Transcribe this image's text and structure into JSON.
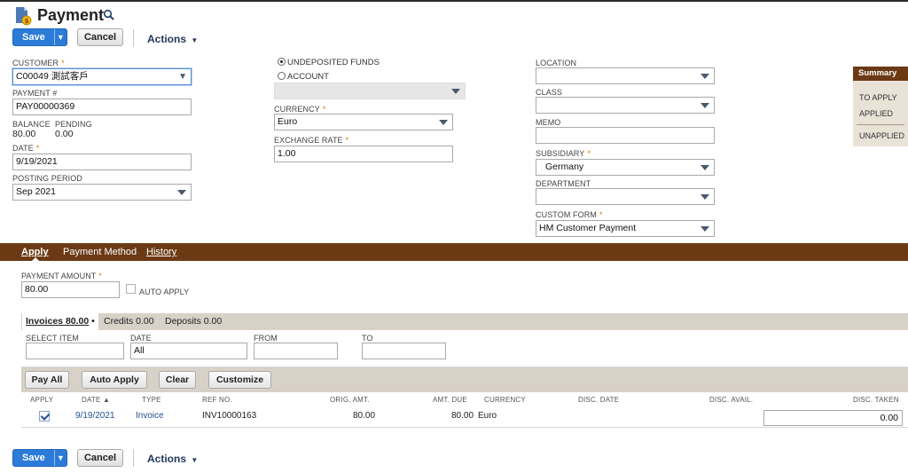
{
  "header": {
    "title": "Payment"
  },
  "toolbar": {
    "save_label": "Save",
    "cancel_label": "Cancel",
    "actions_label": "Actions"
  },
  "fields": {
    "customer": {
      "label": "CUSTOMER",
      "value": "C00049 測試客戶"
    },
    "payment_no": {
      "label": "PAYMENT #",
      "value": "PAY00000369"
    },
    "balance": {
      "label": "BALANCE",
      "value": "80.00"
    },
    "pending": {
      "label": "PENDING",
      "value": "0.00"
    },
    "date": {
      "label": "DATE",
      "value": "9/19/2021"
    },
    "posting_period": {
      "label": "POSTING PERIOD",
      "value": "Sep 2021"
    },
    "undeposited_funds": {
      "label": "UNDEPOSITED FUNDS",
      "checked": true
    },
    "account": {
      "label": "ACCOUNT",
      "value": ""
    },
    "currency": {
      "label": "CURRENCY",
      "value": "Euro"
    },
    "exchange_rate": {
      "label": "EXCHANGE RATE",
      "value": "1.00"
    },
    "location": {
      "label": "LOCATION",
      "value": ""
    },
    "class": {
      "label": "CLASS",
      "value": ""
    },
    "memo": {
      "label": "MEMO",
      "value": ""
    },
    "subsidiary": {
      "label": "SUBSIDIARY",
      "value": "Germany"
    },
    "department": {
      "label": "DEPARTMENT",
      "value": ""
    },
    "custom_form": {
      "label": "CUSTOM FORM",
      "value": "HM Customer Payment"
    }
  },
  "summary": {
    "title": "Summary",
    "to_apply": "TO APPLY",
    "applied": "APPLIED",
    "unapplied": "UNAPPLIED"
  },
  "tabs": [
    {
      "label": "Apply",
      "selected": true
    },
    {
      "label": "Payment Method",
      "selected": false
    },
    {
      "label": "History",
      "selected": false
    }
  ],
  "apply": {
    "payment_amount": {
      "label": "PAYMENT AMOUNT",
      "value": "80.00"
    },
    "auto_apply": {
      "label": "AUTO APPLY",
      "checked": false
    },
    "subtabs": [
      {
        "label": "Invoices 80.00",
        "selected": true
      },
      {
        "label": "Credits 0.00",
        "selected": false
      },
      {
        "label": "Deposits 0.00",
        "selected": false
      }
    ],
    "filters": {
      "select_item": {
        "label": "SELECT ITEM",
        "value": ""
      },
      "date": {
        "label": "DATE",
        "value": "All"
      },
      "from": {
        "label": "FROM",
        "value": ""
      },
      "to": {
        "label": "TO",
        "value": ""
      }
    },
    "buttons": {
      "pay_all": "Pay All",
      "auto_apply": "Auto Apply",
      "clear": "Clear",
      "customize": "Customize"
    },
    "columns": [
      "APPLY",
      "DATE",
      "TYPE",
      "REF NO.",
      "ORIG. AMT.",
      "AMT. DUE",
      "CURRENCY",
      "DISC. DATE",
      "DISC. AVAIL.",
      "DISC. TAKEN"
    ],
    "sort_indicator": "▲",
    "rows": [
      {
        "apply": true,
        "date": "9/19/2021",
        "type": "Invoice",
        "ref_no": "INV10000163",
        "orig_amt": "80.00",
        "amt_due": "80.00",
        "currency": "Euro",
        "disc_date": "",
        "disc_avail": "",
        "disc_taken": "0.00"
      }
    ]
  },
  "colors": {
    "brand_brown": "#6b3a14",
    "primary_blue": "#2b7bd8",
    "link_blue": "#24508c",
    "required_orange": "#e07b00"
  },
  "icons": {
    "page": "payment-document-icon",
    "search": "search-icon",
    "dropdown": "chevron-down-icon"
  }
}
